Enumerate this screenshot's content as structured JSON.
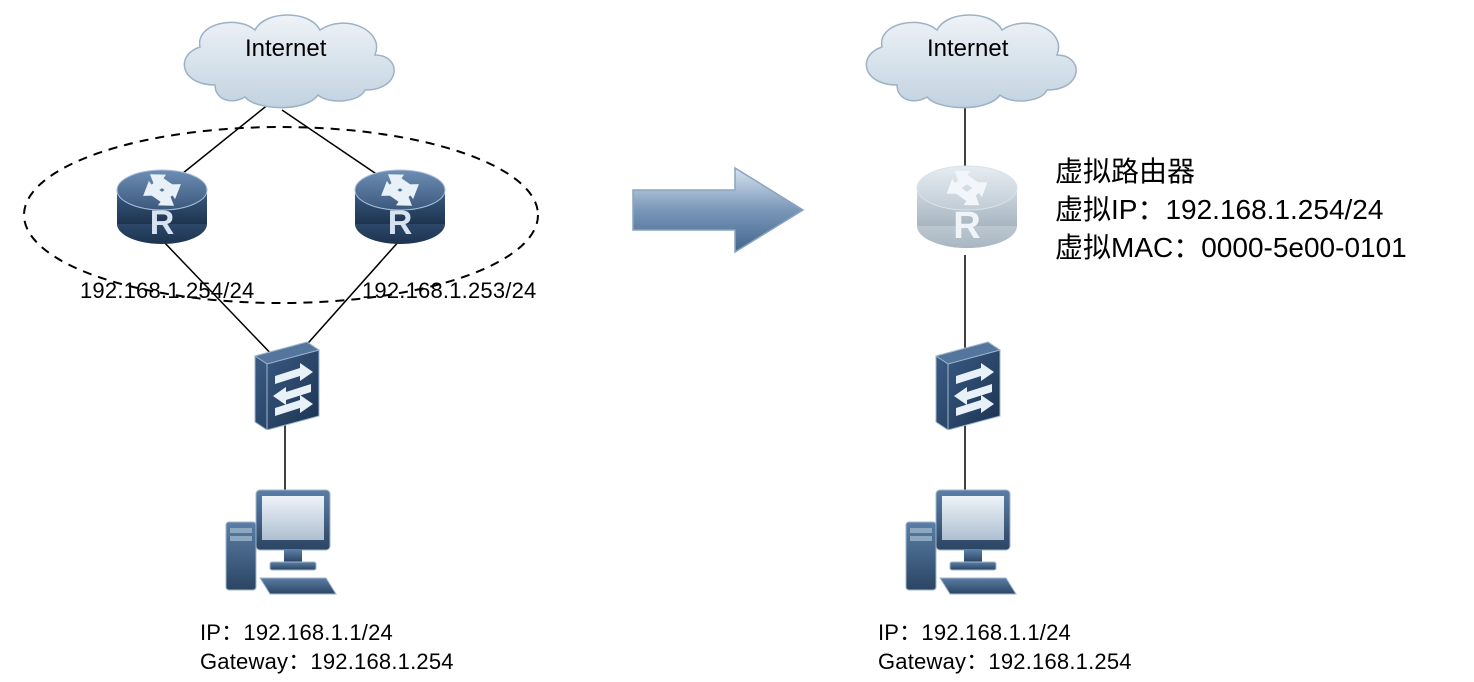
{
  "left": {
    "internet": "Internet",
    "router1_ip": "192.168.1.254/24",
    "router2_ip": "192.168.1.253/24",
    "pc_ip_line": "IP：192.168.1.1/24",
    "pc_gw_line": "Gateway：192.168.1.254"
  },
  "right": {
    "internet": "Internet",
    "vr_title": "虚拟路由器",
    "vr_ip": "虚拟IP：192.168.1.254/24",
    "vr_mac": "虚拟MAC：0000-5e00-0101",
    "pc_ip_line": "IP：192.168.1.1/24",
    "pc_gw_line": "Gateway：192.168.1.254"
  }
}
